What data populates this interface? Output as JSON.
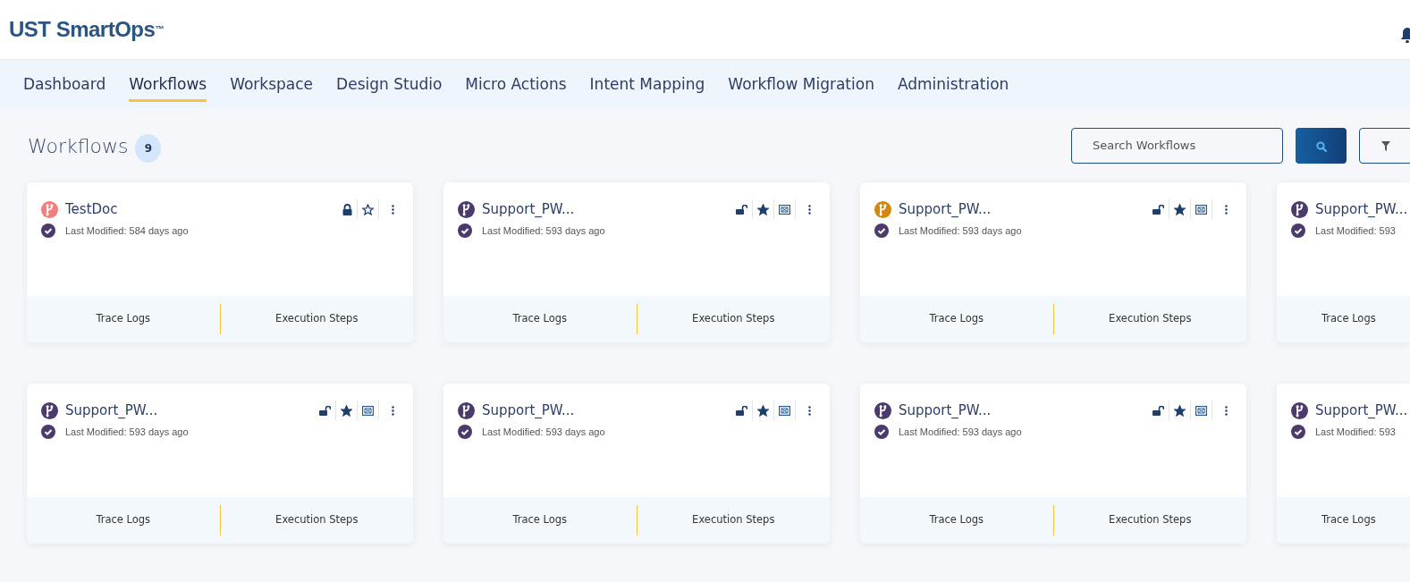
{
  "header": {
    "logo": "UST SmartOps$^{™}$"
  },
  "nav": [
    {
      "label": "Dashboard",
      "selected": false
    },
    {
      "label": "Workflows",
      "selected": true
    },
    {
      "label": "Workspace",
      "selected": false
    },
    {
      "label": "Design Studio",
      "selected": false
    },
    {
      "label": "Micro Actions",
      "selected": false
    },
    {
      "label": "Intent Mapping",
      "selected": false
    },
    {
      "label": "Workflow Migration",
      "selected": false
    },
    {
      "label": "Administration",
      "selected": false
    }
  ],
  "page": {
    "title": "Workflows",
    "count": "9",
    "search": {
      "placeholder": "Search Workflows"
    }
  },
  "cards": [
    {
      "title": "TestDoc",
      "color": "#f47c7c",
      "modified": "Last Modified: 584 days ago",
      "locked": true,
      "starred": false,
      "has_diagram": false,
      "footer": [
        "Trace Logs",
        "Execution Steps"
      ],
      "partial": false
    },
    {
      "title": "Support_PW...",
      "color": "#4b3a6b",
      "modified": "Last Modified: 593 days ago",
      "locked": false,
      "starred": true,
      "has_diagram": true,
      "footer": [
        "Trace Logs",
        "Execution Steps"
      ],
      "partial": false
    },
    {
      "title": "Support_PW...",
      "color": "#d4860f",
      "modified": "Last Modified: 593 days ago",
      "locked": false,
      "starred": true,
      "has_diagram": true,
      "footer": [
        "Trace Logs",
        "Execution Steps"
      ],
      "partial": false
    },
    {
      "title": "Support_PW...",
      "color": "#4b3a6b",
      "modified": "Last Modified: 593",
      "footer": [
        "Trace Logs"
      ],
      "partial": true
    },
    {
      "title": "Support_PW...",
      "color": "#4b3a6b",
      "modified": "Last Modified: 593 days ago",
      "locked": false,
      "starred": true,
      "has_diagram": true,
      "footer": [
        "Trace Logs",
        "Execution Steps"
      ],
      "partial": false
    },
    {
      "title": "Support_PW...",
      "color": "#4b3a6b",
      "modified": "Last Modified: 593 days ago",
      "locked": false,
      "starred": true,
      "has_diagram": true,
      "footer": [
        "Trace Logs",
        "Execution Steps"
      ],
      "partial": false
    },
    {
      "title": "Support_PW...",
      "color": "#4b3a6b",
      "modified": "Last Modified: 593 days ago",
      "locked": false,
      "starred": true,
      "has_diagram": true,
      "footer": [
        "Trace Logs",
        "Execution Steps"
      ],
      "partial": false
    },
    {
      "title": "Support_PW...",
      "color": "#4b3a6b",
      "modified": "Last Modified: 593",
      "footer": [
        "Trace Logs"
      ],
      "partial": true
    }
  ]
}
